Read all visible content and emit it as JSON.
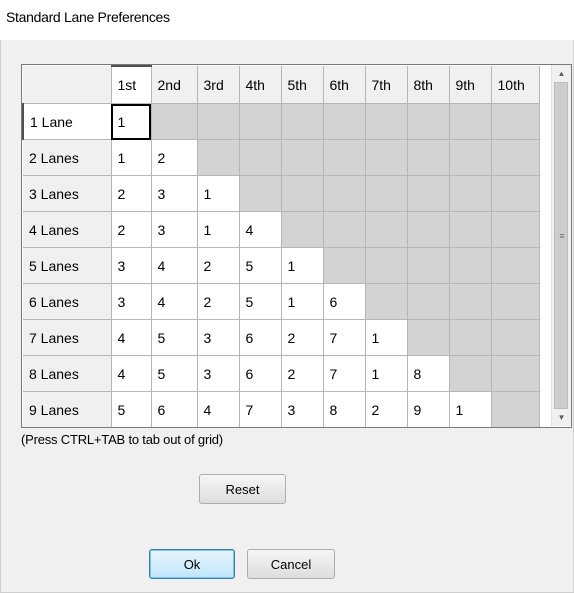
{
  "dialog": {
    "title": "Standard Lane Preferences",
    "hint": "(Press CTRL+TAB to tab out of grid)"
  },
  "grid": {
    "columns": [
      "1st",
      "2nd",
      "3rd",
      "4th",
      "5th",
      "6th",
      "7th",
      "8th",
      "9th",
      "10th"
    ],
    "rows": [
      {
        "label": "1 Lane",
        "values": [
          "1"
        ]
      },
      {
        "label": "2 Lanes",
        "values": [
          "1",
          "2"
        ]
      },
      {
        "label": "3 Lanes",
        "values": [
          "2",
          "3",
          "1"
        ]
      },
      {
        "label": "4 Lanes",
        "values": [
          "2",
          "3",
          "1",
          "4"
        ]
      },
      {
        "label": "5 Lanes",
        "values": [
          "3",
          "4",
          "2",
          "5",
          "1"
        ]
      },
      {
        "label": "6 Lanes",
        "values": [
          "3",
          "4",
          "2",
          "5",
          "1",
          "6"
        ]
      },
      {
        "label": "7 Lanes",
        "values": [
          "4",
          "5",
          "3",
          "6",
          "2",
          "7",
          "1"
        ]
      },
      {
        "label": "8 Lanes",
        "values": [
          "4",
          "5",
          "3",
          "6",
          "2",
          "7",
          "1",
          "8"
        ]
      },
      {
        "label": "9 Lanes",
        "values": [
          "5",
          "6",
          "4",
          "7",
          "3",
          "8",
          "2",
          "9",
          "1"
        ]
      }
    ],
    "selected_row": 0,
    "selected_col": 0,
    "colors": {
      "header_bg": "#f0f0f0",
      "disabled_cell": "#d3d3d3",
      "cell_bg": "#ffffff"
    }
  },
  "buttons": {
    "reset": "Reset",
    "ok": "Ok",
    "cancel": "Cancel"
  },
  "icons": {
    "scroll_up": "▲",
    "scroll_down": "▼",
    "grip": "≡"
  }
}
